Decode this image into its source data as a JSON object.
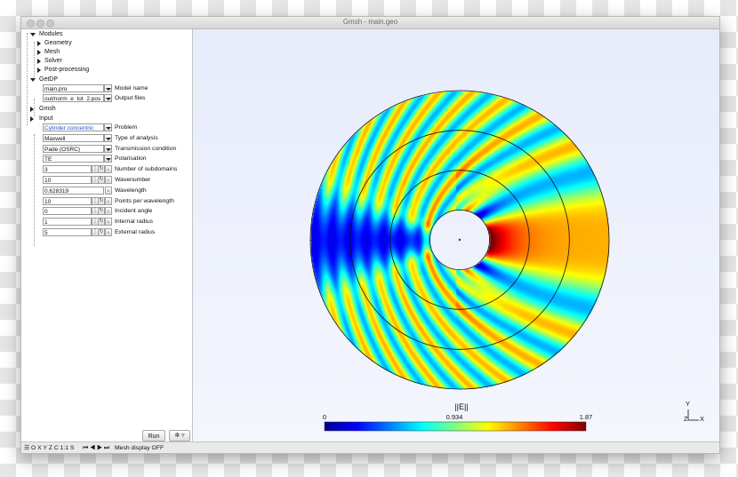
{
  "window": {
    "title": "Gmsh - main.geo"
  },
  "tree": {
    "modules": "Modules",
    "geometry": "Geometry",
    "mesh": "Mesh",
    "solver": "Solver",
    "post_processing": "Post-processing",
    "getdp": "GetDP",
    "gmsh": "Gmsh",
    "input": "Input"
  },
  "getdp_params": {
    "model_value": "main.pro",
    "model_label": "Model name",
    "output_value": "out/norm_e_tot_2.pos",
    "output_label": "Output files"
  },
  "input_params": [
    {
      "value": "Cylinder concentric",
      "label": "Problem",
      "kind": "select"
    },
    {
      "value": "Maxwell",
      "label": "Type of analysis",
      "kind": "select"
    },
    {
      "value": "Pade (OSRC)",
      "label": "Transmission condition",
      "kind": "select"
    },
    {
      "value": "TE",
      "label": "Polarisation",
      "kind": "select"
    },
    {
      "value": "3",
      "label": "Number of subdomains",
      "kind": "number"
    },
    {
      "value": "10",
      "label": "Wavenumber",
      "kind": "number"
    },
    {
      "value": "0.628319",
      "label": "Wavelength",
      "kind": "readonly"
    },
    {
      "value": "10",
      "label": "Points per wavelength",
      "kind": "number"
    },
    {
      "value": "0",
      "label": "Incident angle",
      "kind": "number"
    },
    {
      "value": "1",
      "label": "Internal radius",
      "kind": "number"
    },
    {
      "value": "5",
      "label": "External radius",
      "kind": "number"
    }
  ],
  "buttons": {
    "run": "Run",
    "gear": "✲ ▿"
  },
  "colorbar": {
    "title": "||E||",
    "min": "0",
    "mid": "0.934",
    "max": "1.87",
    "colors": [
      "#00008f",
      "#0000ff",
      "#007fff",
      "#00ffff",
      "#7fff7f",
      "#ffff00",
      "#ff7f00",
      "#ff0000",
      "#7f0000"
    ]
  },
  "axes": {
    "y": "Y",
    "z": "Z",
    "x": "X"
  },
  "statusbar": {
    "views": "O X Y Z C 1:1 S",
    "nav": "⏮ ◀ ▶ ⏭",
    "message": "Mesh display OFF"
  },
  "field_params": {
    "wavenumber": 10,
    "inner_radius": 1,
    "outer_radius": 5,
    "subdomain_radii": [
      2.33,
      3.67
    ]
  }
}
